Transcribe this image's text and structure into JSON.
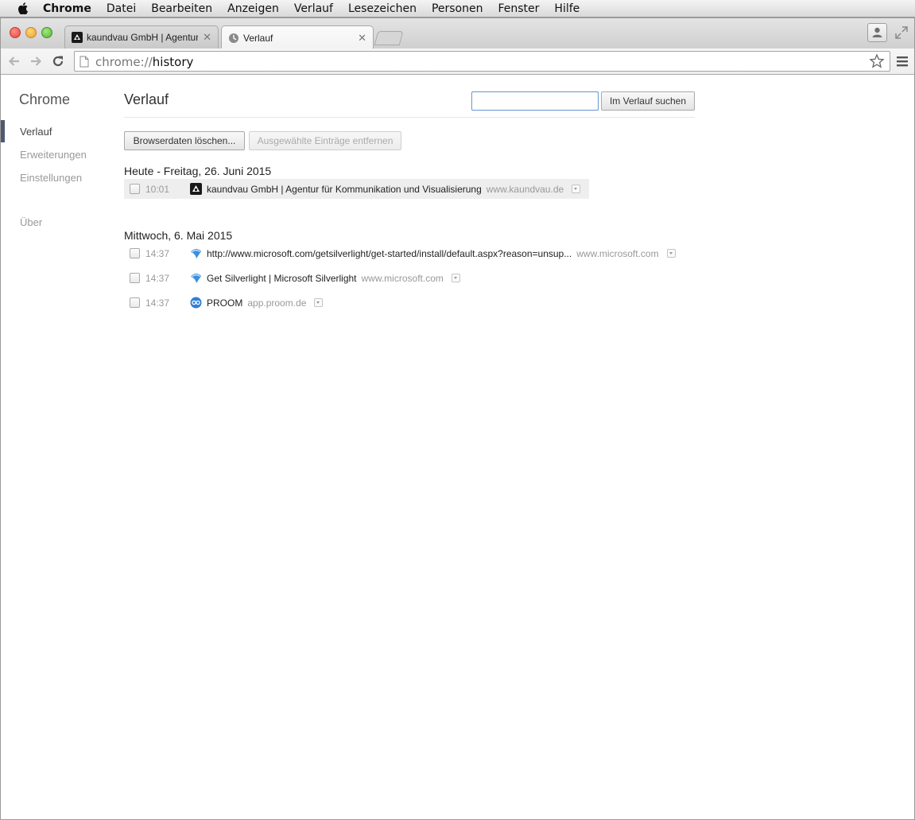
{
  "menubar": {
    "app_name": "Chrome",
    "items": [
      "Datei",
      "Bearbeiten",
      "Anzeigen",
      "Verlauf",
      "Lesezeichen",
      "Personen",
      "Fenster",
      "Hilfe"
    ]
  },
  "tabs": [
    {
      "label": "kaundvau GmbH | Agentur",
      "icon": "kaundvau-favicon",
      "active": false
    },
    {
      "label": "Verlauf",
      "icon": "history-clock-icon",
      "active": true
    }
  ],
  "address_bar": {
    "scheme": "chrome://",
    "path": "history"
  },
  "sidebar": {
    "title": "Chrome",
    "items": [
      {
        "label": "Verlauf",
        "active": true
      },
      {
        "label": "Erweiterungen",
        "active": false
      },
      {
        "label": "Einstellungen",
        "active": false
      },
      {
        "label": "Über",
        "active": false
      }
    ]
  },
  "page": {
    "title": "Verlauf",
    "search_button": "Im Verlauf suchen",
    "search_value": "",
    "clear_button": "Browserdaten löschen...",
    "remove_button": "Ausgewählte Einträge entfernen"
  },
  "history": [
    {
      "date": "Heute - Freitag, 26. Juni 2015",
      "entries": [
        {
          "time": "10:01",
          "title": "kaundvau GmbH | Agentur für Kommunikation und Visualisierung",
          "domain": "www.kaundvau.de",
          "icon": "kaundvau-favicon"
        }
      ]
    },
    {
      "date": "Mittwoch, 6. Mai 2015",
      "entries": [
        {
          "time": "14:37",
          "title": "http://www.microsoft.com/getsilverlight/get-started/install/default.aspx?reason=unsup...",
          "domain": "www.microsoft.com",
          "icon": "silverlight-favicon"
        },
        {
          "time": "14:37",
          "title": "Get Silverlight | Microsoft Silverlight",
          "domain": "www.microsoft.com",
          "icon": "silverlight-favicon"
        },
        {
          "time": "14:37",
          "title": "PROOM",
          "domain": "app.proom.de",
          "icon": "proom-favicon"
        }
      ]
    }
  ],
  "colors": {
    "active_nav_bar": "#4d5a6e",
    "search_focus_border": "#6d9ad8"
  }
}
